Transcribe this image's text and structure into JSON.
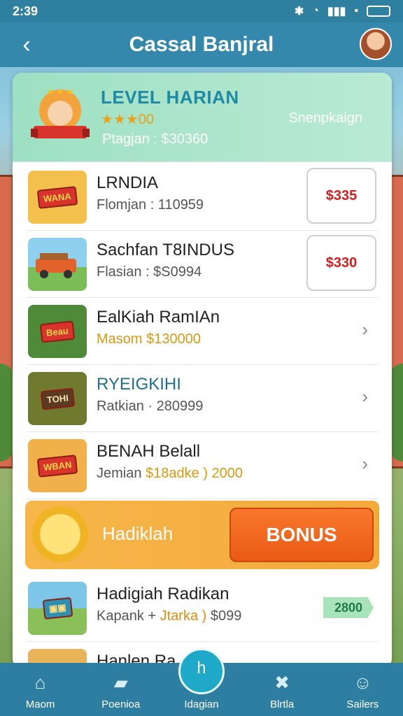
{
  "status": {
    "time": "2:39"
  },
  "header": {
    "title": "Cassal Banjral"
  },
  "banner": {
    "title": "LEVEL HARIAN",
    "stars": "★★★00",
    "subtitle": "Ptagjan : $30360",
    "right_text": "Snenpkaign"
  },
  "rows": [
    {
      "title": "LRNDIA",
      "subtitle": "Flomjan : 110959",
      "price": "$335",
      "tag": "WANA"
    },
    {
      "title": "Sachfan T8INDUS",
      "subtitle": "Flasian : $S0994",
      "price": "$330",
      "tag": ""
    },
    {
      "title": "EalKiah RamIAn",
      "subtitle": "Masom $130000",
      "tag": "Beau"
    },
    {
      "title": "RYEIGKIHI",
      "subtitle": "Ratkian · 280999",
      "tag": "TOHI"
    },
    {
      "title": "BENAH Belall",
      "subtitle_a": "Jemian ",
      "subtitle_b": "$18adke ) 2000",
      "tag": "WBAN"
    }
  ],
  "bonus": {
    "label": "Hadiklah",
    "button": "BONUS"
  },
  "reward_row": {
    "title": "Hadigiah Radikan",
    "subtitle_a": "Kapank + ",
    "subtitle_b": "Jtarka )",
    "subtitle_c": " $099",
    "badge": "2800"
  },
  "partial_row": {
    "title": "Hanlen Ra..."
  },
  "nav": [
    {
      "label": "Maom"
    },
    {
      "label": "Poenioa"
    },
    {
      "label": "Idagian"
    },
    {
      "label": "Blrtla"
    },
    {
      "label": "Sailers"
    }
  ],
  "colors": {
    "accent": "#3388ab",
    "bonus": "#f4a93b",
    "price": "#d11f1f",
    "nav": "#2d7ea0"
  }
}
